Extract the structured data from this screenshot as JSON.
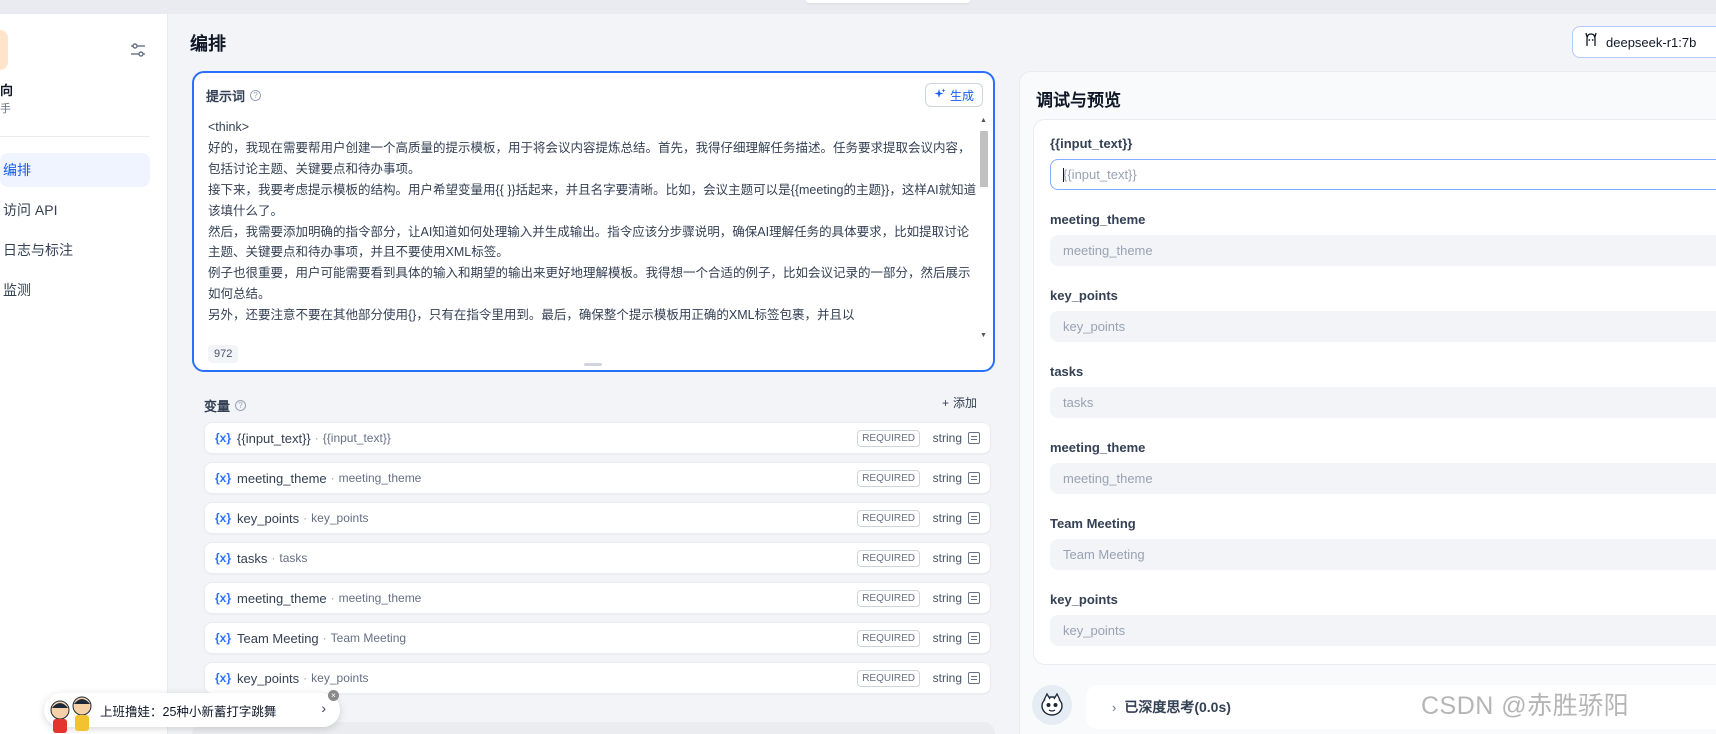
{
  "sidebar": {
    "app_name": "向",
    "app_desc": "手",
    "nav": [
      {
        "label": "编排"
      },
      {
        "label": "访问 API"
      },
      {
        "label": "日志与标注"
      },
      {
        "label": "监测"
      }
    ]
  },
  "header": {
    "title": "编排",
    "model_name": "deepseek-r1:7b"
  },
  "prompt": {
    "title": "提示词",
    "help": "?",
    "generate_label": "生成",
    "lines": [
      "<think>",
      "好的，我现在需要帮用户创建一个高质量的提示模板，用于将会议内容提炼总结。首先，我得仔细理解任务描述。任务要求提取会议内容，包括讨论主题、关键要点和待办事项。",
      "接下来，我要考虑提示模板的结构。用户希望变量用{{ }}括起来，并且名字要清晰。比如，会议主题可以是{{meeting的主题}}，这样AI就知道该填什么了。",
      "然后，我需要添加明确的指令部分，让AI知道如何处理输入并生成输出。指令应该分步骤说明，确保AI理解任务的具体要求，比如提取讨论主题、关键要点和待办事项，并且不要使用XML标签。",
      "例子也很重要，用户可能需要看到具体的输入和期望的输出来更好地理解模板。我得想一个合适的例子，比如会议记录的一部分，然后展示如何总结。",
      "另外，还要注意不要在其他部分使用{}，只有在指令里用到。最后，确保整个提示模板用正确的XML标签包裹，并且以"
    ],
    "char_count": "972"
  },
  "variables": {
    "title": "变量",
    "help": "?",
    "add_label": "添加",
    "add_glyph": "+",
    "items": [
      {
        "glyph": "{x}",
        "key": "{{input_text}}",
        "sep": "·",
        "label": "{{input_text}}",
        "required": "REQUIRED",
        "type": "string"
      },
      {
        "glyph": "{x}",
        "key": "meeting_theme",
        "sep": "·",
        "label": "meeting_theme",
        "required": "REQUIRED",
        "type": "string"
      },
      {
        "glyph": "{x}",
        "key": "key_points",
        "sep": "·",
        "label": "key_points",
        "required": "REQUIRED",
        "type": "string"
      },
      {
        "glyph": "{x}",
        "key": "tasks",
        "sep": "·",
        "label": "tasks",
        "required": "REQUIRED",
        "type": "string"
      },
      {
        "glyph": "{x}",
        "key": "meeting_theme",
        "sep": "·",
        "label": "meeting_theme",
        "required": "REQUIRED",
        "type": "string"
      },
      {
        "glyph": "{x}",
        "key": "Team Meeting",
        "sep": "·",
        "label": "Team Meeting",
        "required": "REQUIRED",
        "type": "string"
      },
      {
        "glyph": "{x}",
        "key": "key_points",
        "sep": "·",
        "label": "key_points",
        "required": "REQUIRED",
        "type": "string"
      }
    ]
  },
  "debug": {
    "title": "调试与预览",
    "fields": [
      {
        "label": "{{input_text}}",
        "placeholder": "{{input_text}}"
      },
      {
        "label": "meeting_theme",
        "placeholder": "meeting_theme"
      },
      {
        "label": "key_points",
        "placeholder": "key_points"
      },
      {
        "label": "tasks",
        "placeholder": "tasks"
      },
      {
        "label": "meeting_theme",
        "placeholder": "meeting_theme"
      },
      {
        "label": "Team Meeting",
        "placeholder": "Team Meeting"
      },
      {
        "label": "key_points",
        "placeholder": "key_points"
      }
    ],
    "thinking_label": "已深度思考(0.0s)",
    "thinking_chevron": "›"
  },
  "toast": {
    "text": "上班撸娃：25种小新蓄打字跳舞",
    "chevron": "›",
    "close": "×"
  },
  "watermark": "CSDN @赤胜骄阳",
  "colors": {
    "accent": "#2970ff",
    "active_nav_bg": "#eff4ff",
    "page_bg": "#f2f4f7"
  },
  "icons": {
    "settings": "sliders-icon",
    "generate": "sparkle-icon",
    "model": "llama-icon",
    "help": "question-circle-icon",
    "variable": "variable-braces-icon",
    "edit": "edit-field-icon",
    "bot": "bot-avatar-icon"
  }
}
